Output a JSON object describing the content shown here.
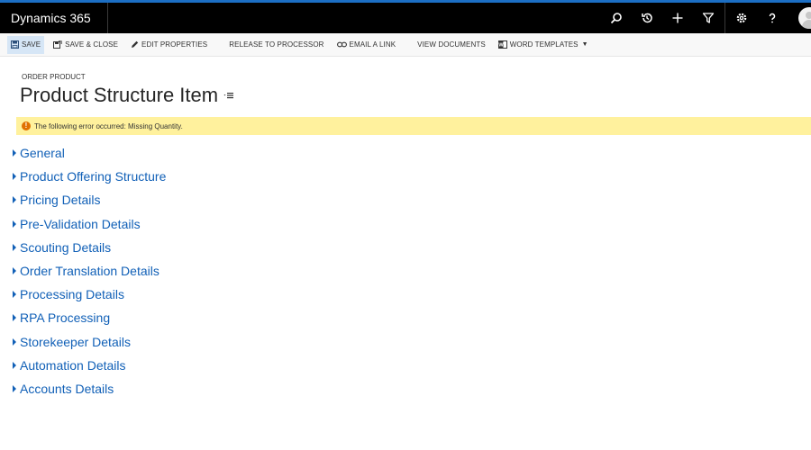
{
  "app": {
    "title": "Dynamics 365"
  },
  "nav_icons": [
    "search-icon",
    "recent-icon",
    "new-record-icon",
    "advanced-find-icon",
    "settings-icon",
    "help-icon",
    "user-avatar"
  ],
  "commands": {
    "save": "SAVE",
    "save_close": "SAVE & CLOSE",
    "edit_properties": "EDIT PROPERTIES",
    "release": "RELEASE TO PROCESSOR",
    "email_link": "EMAIL A LINK",
    "view_documents": "VIEW DOCUMENTS",
    "word_templates": "WORD TEMPLATES"
  },
  "header": {
    "entity": "ORDER PRODUCT",
    "title": "Product Structure Item"
  },
  "notification": {
    "text": "The following error occurred: Missing Quantity."
  },
  "sections": [
    "General",
    "Product Offering Structure",
    "Pricing Details",
    "Pre-Validation Details",
    "Scouting Details",
    "Order Translation Details",
    "Processing Details",
    "RPA Processing",
    "Storekeeper Details",
    "Automation Details",
    "Accounts Details"
  ],
  "colors": {
    "accent": "#1c6fc4",
    "link": "#1160b7",
    "warning_bg": "#fff19d",
    "warning_icon": "#e07000"
  }
}
